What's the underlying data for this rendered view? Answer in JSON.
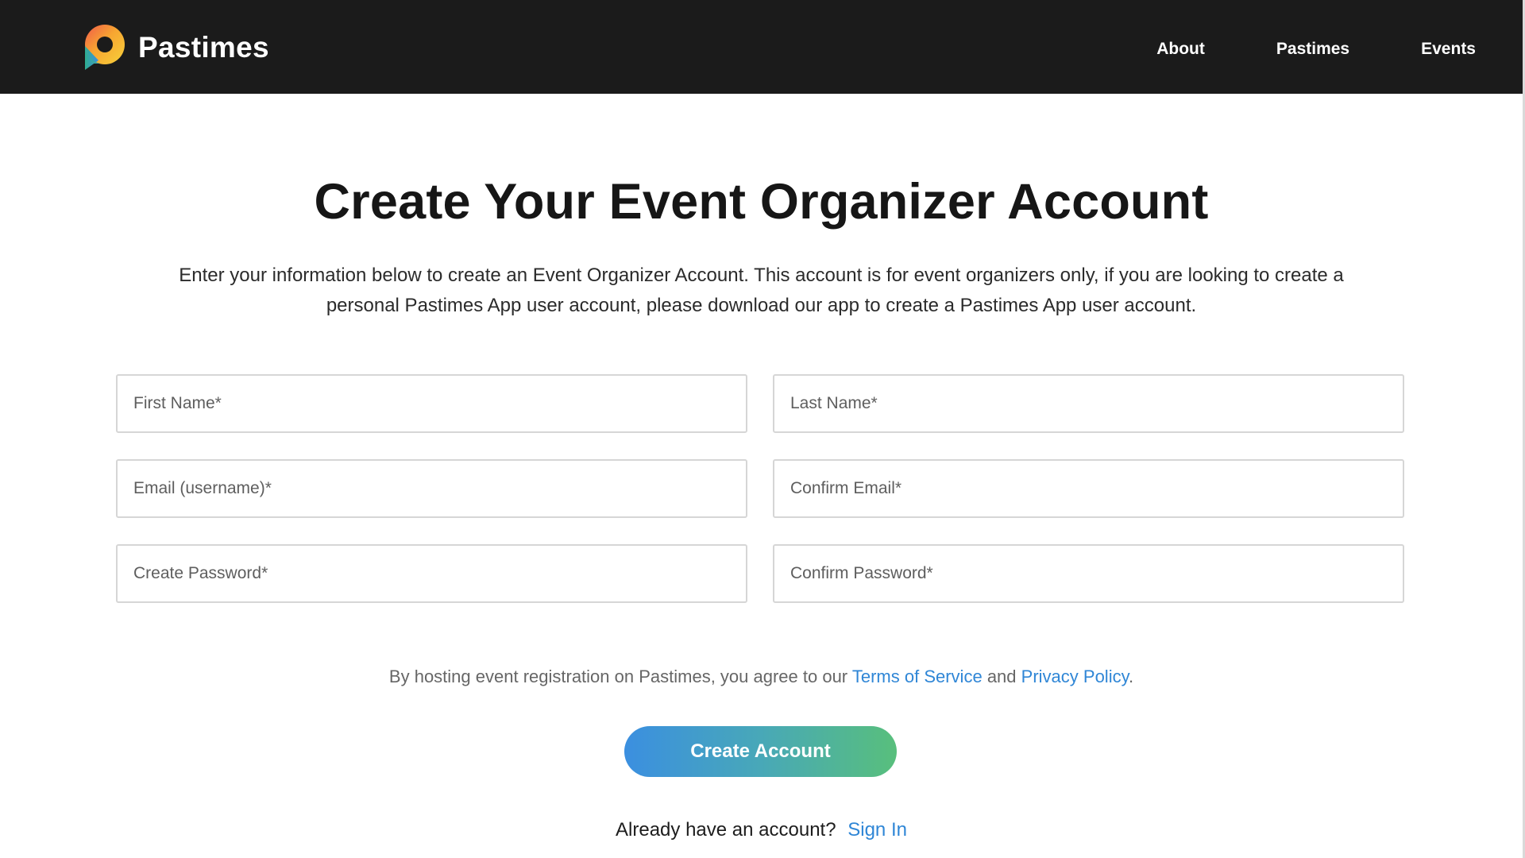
{
  "header": {
    "brand_name": "Pastimes",
    "logo_icon": "pastimes-speech-bubble-logo",
    "nav": [
      {
        "label": "About"
      },
      {
        "label": "Pastimes"
      },
      {
        "label": "Events"
      }
    ]
  },
  "main": {
    "title": "Create Your Event Organizer Account",
    "intro": "Enter your information below to create an Event Organizer Account. This account is for event organizers only, if you are looking to create a personal Pastimes App user account, please download our app to create a Pastimes App user account.",
    "fields": {
      "first_name": {
        "placeholder": "First Name*",
        "value": ""
      },
      "last_name": {
        "placeholder": "Last Name*",
        "value": ""
      },
      "email": {
        "placeholder": "Email (username)*",
        "value": ""
      },
      "confirm_email": {
        "placeholder": "Confirm Email*",
        "value": ""
      },
      "password": {
        "placeholder": "Create Password*",
        "value": ""
      },
      "confirm_password": {
        "placeholder": "Confirm Password*",
        "value": ""
      }
    },
    "terms": {
      "prefix": "By hosting event registration on Pastimes, you agree to our",
      "terms_link": "Terms of Service",
      "conjunction": "and",
      "privacy_link": "Privacy Policy",
      "suffix": "."
    },
    "create_button": "Create Account",
    "signin": {
      "prompt": "Already have an account?",
      "link": "Sign In"
    }
  },
  "colors": {
    "header_bg": "#1b1b1b",
    "link": "#2f86d6",
    "button_gradient_start": "#3b8fe0",
    "button_gradient_end": "#58bf7c"
  }
}
